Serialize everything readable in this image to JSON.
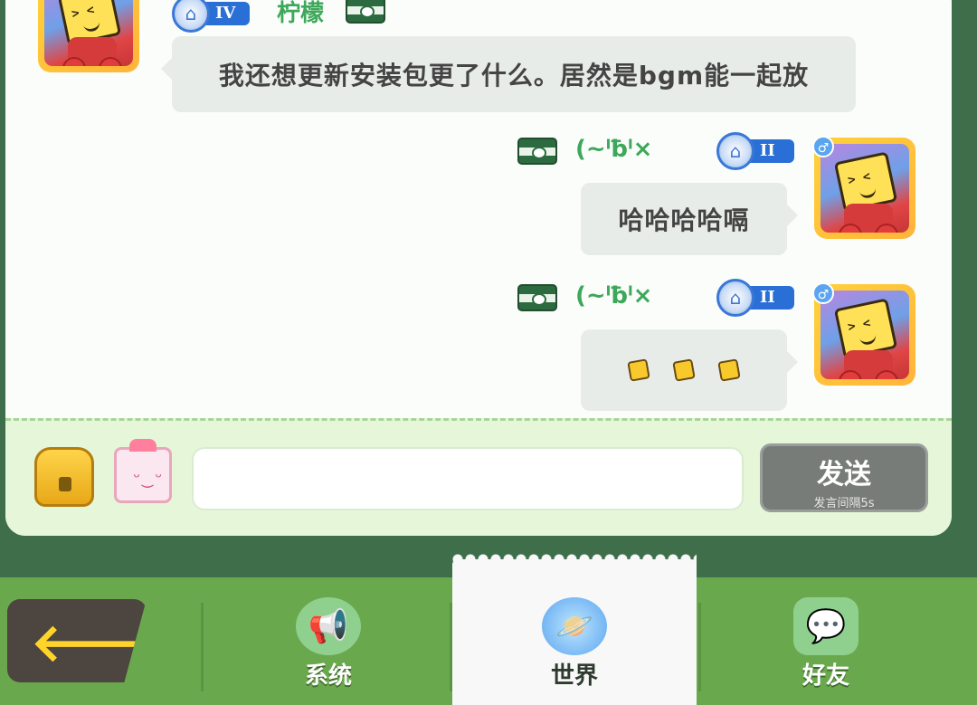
{
  "messages": [
    {
      "side": "left",
      "rank": "IV",
      "name": "柠檬",
      "text": "我还想更新安装包更了什么。居然是bgm能一起放",
      "gender_icon": "female-icon"
    },
    {
      "side": "right",
      "rank": "II",
      "name": "(~ˡƀˡ×",
      "text": "哈哈哈哈嗝",
      "gender_icon": "male-icon"
    },
    {
      "side": "right",
      "rank": "II",
      "name": "(~ˡƀˡ×",
      "text": "",
      "stickers": 3,
      "gender_icon": "male-icon"
    }
  ],
  "input": {
    "value": "",
    "send_label": "发送",
    "cooldown_label": "发言间隔5s"
  },
  "nav": {
    "back_icon": "arrow-left-icon",
    "tabs": [
      {
        "label": "系统",
        "icon": "megaphone-icon",
        "active": false
      },
      {
        "label": "世界",
        "icon": "planet-icon",
        "active": true
      },
      {
        "label": "好友",
        "icon": "chat-bubbles-icon",
        "active": false
      }
    ]
  },
  "colors": {
    "panel_bg": "#fbfdfb",
    "input_area_bg": "#e6f6d9",
    "nav_bg": "#6aa84d",
    "name_green": "#3da85a",
    "send_button": "#777c78",
    "rank_blue": "#2a6fd6"
  }
}
